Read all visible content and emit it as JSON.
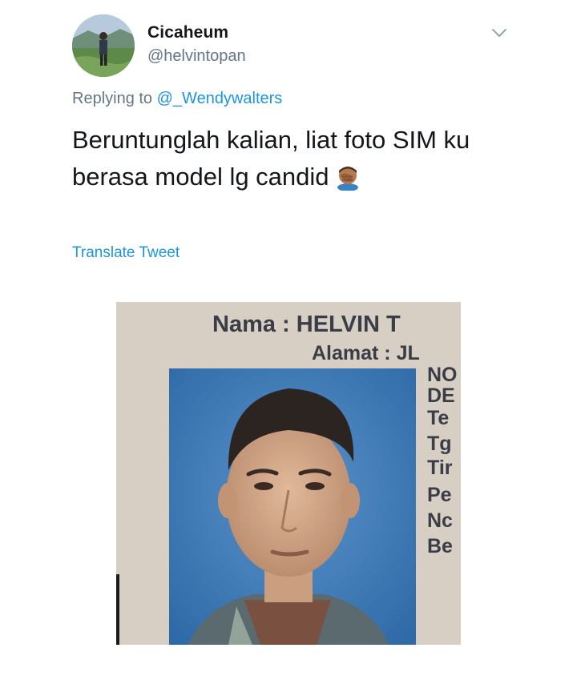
{
  "tweet": {
    "display_name": "Cicaheum",
    "handle": "@helvintopan",
    "reply_prefix": "Replying to",
    "reply_mention": "@_Wendywalters",
    "text_line1": "Beruntunglah kalian, liat foto SIM ku",
    "text_line2": "berasa model lg candid",
    "emoji": "face-palm-emoji",
    "translate_label": "Translate Tweet"
  },
  "id_card": {
    "nama": "Nama : HELVIN T",
    "alamat": "Alamat : JL",
    "fragments": [
      "NO",
      "DE",
      "Te",
      "Tg",
      "Tir",
      "Pe",
      "Nc",
      "Be"
    ]
  },
  "colors": {
    "text": "#14171a",
    "secondary": "#657786",
    "link": "#1b95e0",
    "photo_blue_bg": "#3a78b8"
  },
  "icons": {
    "menu": "chevron-down-icon",
    "avatar": "avatar-image"
  }
}
